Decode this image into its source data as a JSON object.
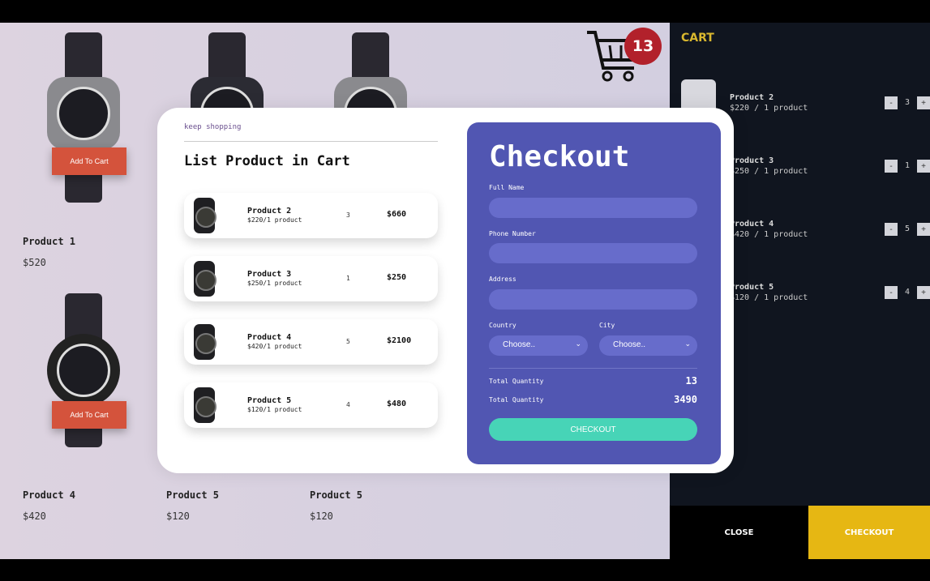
{
  "products": [
    {
      "name": "Product 1",
      "price": "$520",
      "add": "Add To Cart"
    },
    {
      "name": "Product 4",
      "price": "$420",
      "add": "Add To Cart"
    },
    {
      "name": "Product 5",
      "price": "$120"
    },
    {
      "name": "Product 5",
      "price": "$120"
    }
  ],
  "cart_badge": "13",
  "sidebar": {
    "title": "CART",
    "items": [
      {
        "name": "Product 2",
        "price": "$220 / 1 product",
        "qty": "3"
      },
      {
        "name": "Product 3",
        "price": "$250 / 1 product",
        "qty": "1"
      },
      {
        "name": "Product 4",
        "price": "$420 / 1 product",
        "qty": "5"
      },
      {
        "name": "Product 5",
        "price": "$120 / 1 product",
        "qty": "4"
      }
    ],
    "minus": "-",
    "plus": "+",
    "close": "CLOSE",
    "checkout": "CHECKOUT"
  },
  "modal": {
    "keep_shopping": "keep shopping",
    "title": "List Product in Cart",
    "items": [
      {
        "name": "Product 2",
        "price": "$220/1 product",
        "qty": "3",
        "total": "$660"
      },
      {
        "name": "Product 3",
        "price": "$250/1 product",
        "qty": "1",
        "total": "$250"
      },
      {
        "name": "Product 4",
        "price": "$420/1 product",
        "qty": "5",
        "total": "$2100"
      },
      {
        "name": "Product 5",
        "price": "$120/1 product",
        "qty": "4",
        "total": "$480"
      }
    ],
    "checkout": {
      "title": "Checkout",
      "full_name": "Full Name",
      "phone": "Phone Number",
      "address": "Address",
      "country": "Country",
      "city": "City",
      "country_value": "Choose..",
      "city_value": "Choose..",
      "total_qty_label": "Total Quantity",
      "total_qty": "13",
      "total_price_label": "Total Quantity",
      "total_price": "3490",
      "button": "CHECKOUT"
    }
  },
  "colors": {
    "accent": "#5156b2",
    "checkout_button": "#47d4b7",
    "cart_title": "#d9b72e",
    "add_to_cart": "#d4533c",
    "badge": "#b2212b"
  }
}
